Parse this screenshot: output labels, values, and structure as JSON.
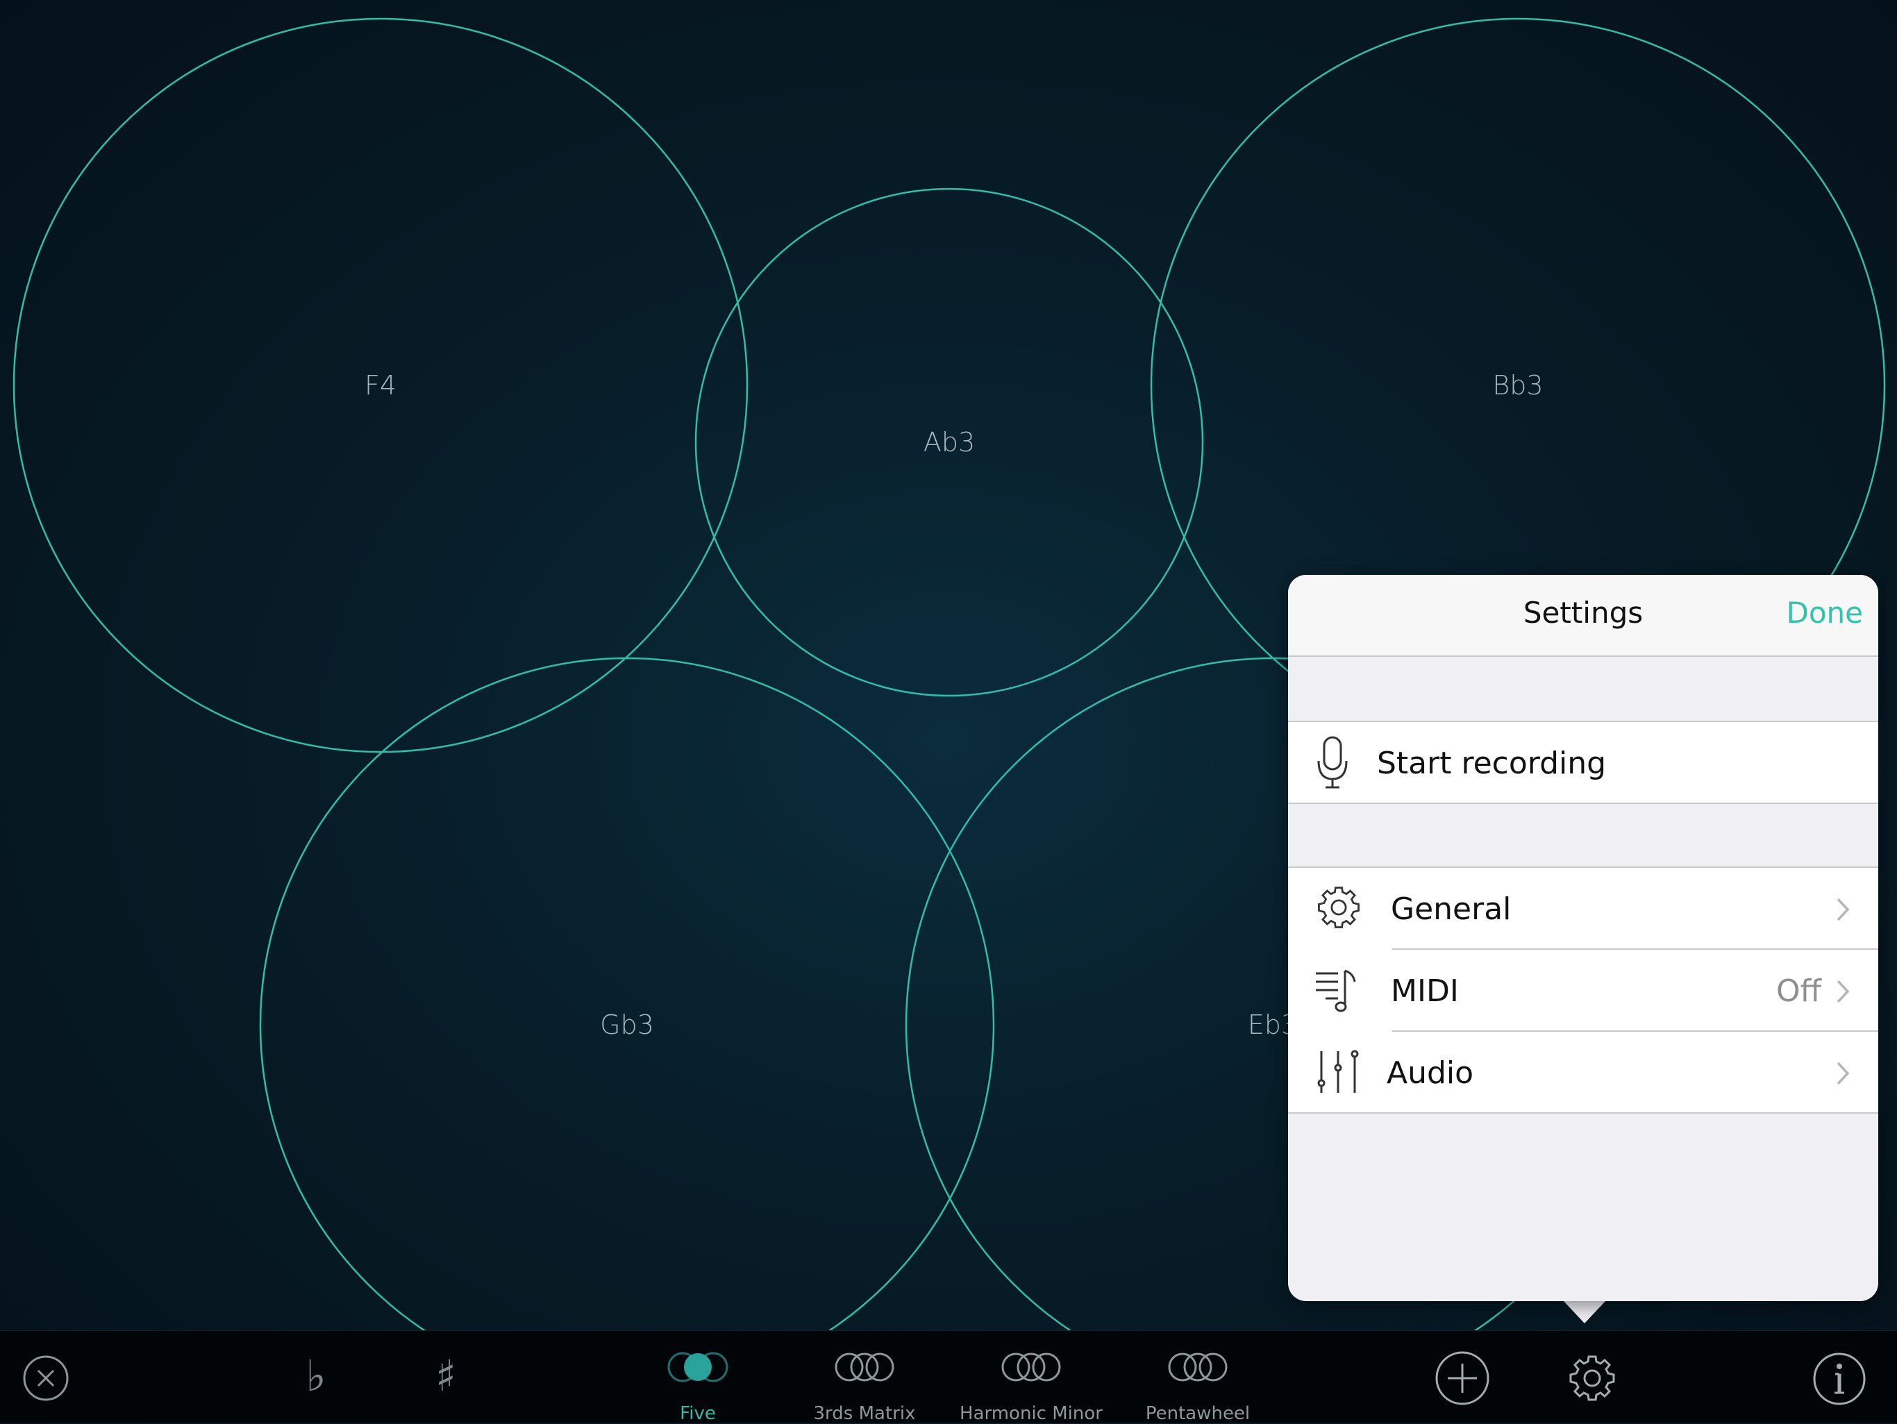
{
  "pads": [
    {
      "note": "F4"
    },
    {
      "note": "Ab3"
    },
    {
      "note": "Bb3"
    },
    {
      "note": "Gb3"
    },
    {
      "note": "Eb3"
    }
  ],
  "colors": {
    "accent": "#33c3a9",
    "pad_ring": "#2fbfa6",
    "panel_bg": "#efeff4"
  },
  "toolbar": {
    "close_icon": "close-circle-icon",
    "flat_label": "♭",
    "sharp_label": "♯",
    "tabs": [
      {
        "label": "Five",
        "active": true
      },
      {
        "label": "3rds Matrix",
        "active": false
      },
      {
        "label": "Harmonic Minor",
        "active": false
      },
      {
        "label": "Pentawheel",
        "active": false
      }
    ],
    "add_icon": "plus-circle-icon",
    "settings_icon": "gear-icon",
    "info_icon": "info-circle-icon"
  },
  "settings": {
    "title": "Settings",
    "done_label": "Done",
    "recording": {
      "label": "Start recording",
      "icon": "microphone-icon"
    },
    "items": [
      {
        "label": "General",
        "value": "",
        "icon": "gear-icon"
      },
      {
        "label": "MIDI",
        "value": "Off",
        "icon": "midi-note-icon"
      },
      {
        "label": "Audio",
        "value": "",
        "icon": "mixer-sliders-icon"
      }
    ]
  }
}
